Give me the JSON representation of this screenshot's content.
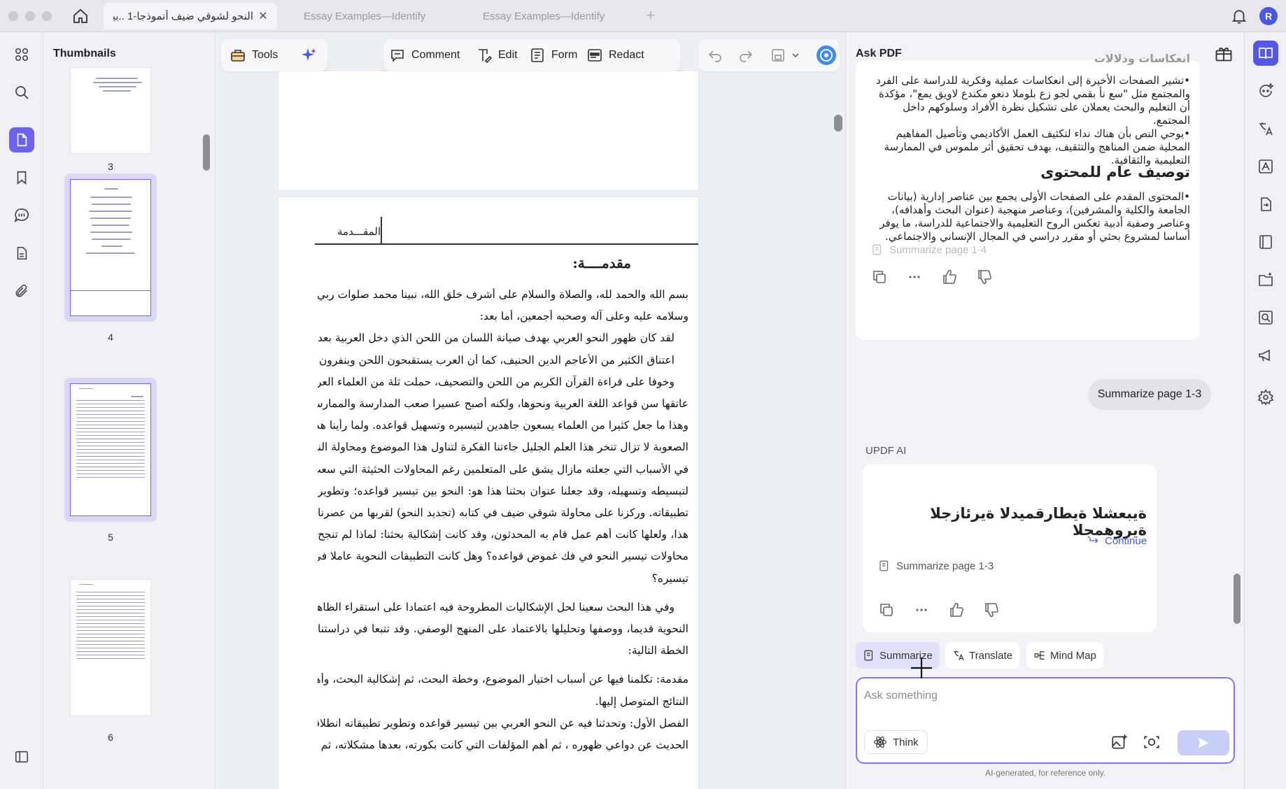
{
  "tabs": [
    {
      "label": "النحو لشوقي ضيف أنموذجا-1 ..بين",
      "active": true
    },
    {
      "label": "Essay Examples—Identify",
      "active": false
    },
    {
      "label": "Essay Examples—Identify",
      "active": false
    }
  ],
  "user": {
    "initial": "R"
  },
  "thumbnails": {
    "title": "Thumbnails",
    "pages": [
      "3",
      "4",
      "5",
      "6"
    ]
  },
  "toolbar": {
    "tools": "Tools",
    "comment": "Comment",
    "edit": "Edit",
    "form": "Form",
    "redact": "Redact"
  },
  "document": {
    "header_label": "المقـــدمة",
    "section_title": "مقدمــــة:",
    "lines": [
      "بسم الله والحمد لله، والصلاة والسلام على أشرف خلق الله، نبينا محمد صلوات ربي",
      "وسلامه عليه وعلى آله وصحبه أجمعين، أما بعد:",
      "لقد كان ظهور النحو العربي بهدف صيانة اللسان من اللحن الذي دخل العربية بعد",
      "اعتناق الكثير من الأعاجم الدين الحنيف، كما أن العرب يستقبحون اللحن وينفرون منه.",
      "وخوفا على قراءة القرآن الكريم من اللحن والتصحيف، حملت ثلة من العلماء العرب على",
      "عاتقها سن قواعد اللغة العربية ونحوها، ولكنه أصبح عسيرا صعب المدارسة والممارسة،",
      "وهذا ما جعل كثيرا من العلماء يسعون جاهدين لتيسيره وتسهيل قواعده. ولما رأينا هذه",
      "الصعوبة لا تزال تنخر هذا العلم الجليل جاءتنا الفكرة لتناول هذا الموضوع ومحاولة النظر",
      "في الأسباب التي جعلته مازال يشق على المتعلمين رغم المحاولات الحثيثة التي سعت",
      "لتبسيطه وتسهيله، وقد جعلنا عنوان بحثنا هذا هو: النحو بين تيسير قواعده؛ وتطوير",
      "تطبيقاته. وركزنا على محاولة شوقي ضيف في كتابه (تجديد النحو) لقربها من عصرنا",
      "هذا، ولعلها كانت أهم عمل قام به المحدثون، وقد كانت إشكالية بحثنا: لماذا لم تنجح",
      "محاولات تيسير النحو في فك غموض قواعده؟ وهل كانت التطبيقات النحوية عاملا في",
      "تيسيره؟",
      "وفي هذا البحث سعينا لحل الإشكاليات المطروحة فيه اعتمادا على استقراء الظاهرة",
      "النحوية قديما، ووصفها وتحليلها بالاعتماد على المنهج الوصفي. وقد تتبعا في دراستنا",
      "الخطة التالية:",
      "مقدمة: تكلمنا فيها عن أسباب اختيار الموضوع، وخطة البحث، ثم إشكالية البحث، وأهم",
      "النتائج المتوصل إليها.",
      "الفصل الأول: وتحدثنا فيه عن النحو العربي بين تيسير قواعده وتطوير تطبيقاته انطلاقا من",
      "الحديث عن دواعي ظهوره ، ثم أهم المؤلفات التي كانت بكورته، بعدها مشكلاته، ثم دعاة"
    ]
  },
  "ai": {
    "title": "Ask PDF",
    "card1": {
      "top_cut": "انعكاسات ودلالات",
      "para1": "•تشير الصفحات الأخيرة إلى انعكاسات عملية وفكرية للدراسة على الفرد والمجتمع مثل \"سع نأ بقمي لجو زع بلوملا دنعو مكندع لاويق يمع\"، مؤكدة أن التعليم والبحث يعملان على تشكيل نظرة الأفراد وسلوكهم داخل المجتمع.",
      "para2": "•يوحي النص بأن هناك نداء لتكثيف العمل الأكاديمي وتأصيل المفاهيم المحلية ضمن المناهج والتثقيف، بهدف تحقيق أثر ملموس في الممارسة التعليمية والثقافية.",
      "heading": "توصيف عام للمحتوى",
      "para3": "•المحتوى المقدم على الصفحات الأولى يجمع بين عناصر إدارية (بيانات الجامعة والكلية والمشرفين)، وعناصر منهجية (عنوان البحث وأهدافه)، وعناصر وصفية أدبية تعكس الروح التعليمية والاجتماعية للدراسة، ما يوفر أساسا لمشروع بحثي أو مقرر دراسي في المجال الإنساني والاجتماعي.",
      "source": "Summarize page 1-4"
    },
    "user_bubble": "Summarize page 1-3",
    "assistant_label": "UPDF AI",
    "card2": {
      "heading": "ةيبعشلا ةيطارقميدلا ةيرئازجلا ةيروهمجلا",
      "source": "Summarize page 1-3",
      "continue": "Continue"
    },
    "chips": [
      "Summarize",
      "Translate",
      "Mind Map"
    ],
    "input_placeholder": "Ask something",
    "think": "Think",
    "disclaimer": "AI-generated, for reference only."
  }
}
